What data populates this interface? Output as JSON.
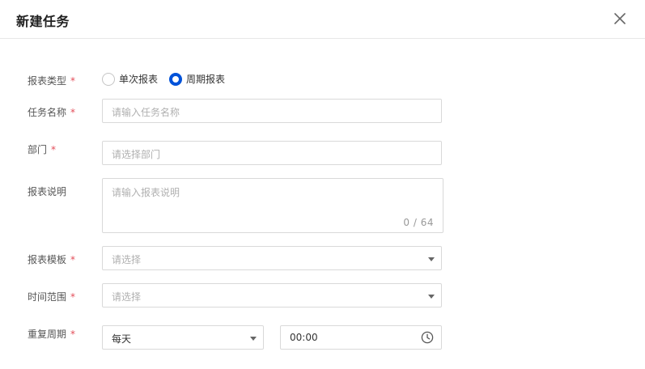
{
  "dialog": {
    "title": "新建任务",
    "close_icon": "close-icon"
  },
  "form": {
    "required_mark": "*",
    "report_type": {
      "label": "报表类型",
      "options": [
        {
          "label": "单次报表",
          "checked": false
        },
        {
          "label": "周期报表",
          "checked": true
        }
      ]
    },
    "task_name": {
      "label": "任务名称",
      "placeholder": "请输入任务名称"
    },
    "department": {
      "label": "部门",
      "placeholder": "请选择部门"
    },
    "description": {
      "label": "报表说明",
      "placeholder": "请输入报表说明",
      "counter": "0 / 64"
    },
    "template": {
      "label": "报表模板",
      "placeholder": "请选择"
    },
    "time_range": {
      "label": "时间范围",
      "placeholder": "请选择"
    },
    "repeat": {
      "label": "重复周期",
      "frequency_value": "每天",
      "time_value": "00:00",
      "time_icon": "clock-icon"
    }
  },
  "colors": {
    "accent": "#0052d9",
    "required": "#e34d59",
    "border": "#d9d9d9",
    "placeholder": "#b0b0b0"
  }
}
